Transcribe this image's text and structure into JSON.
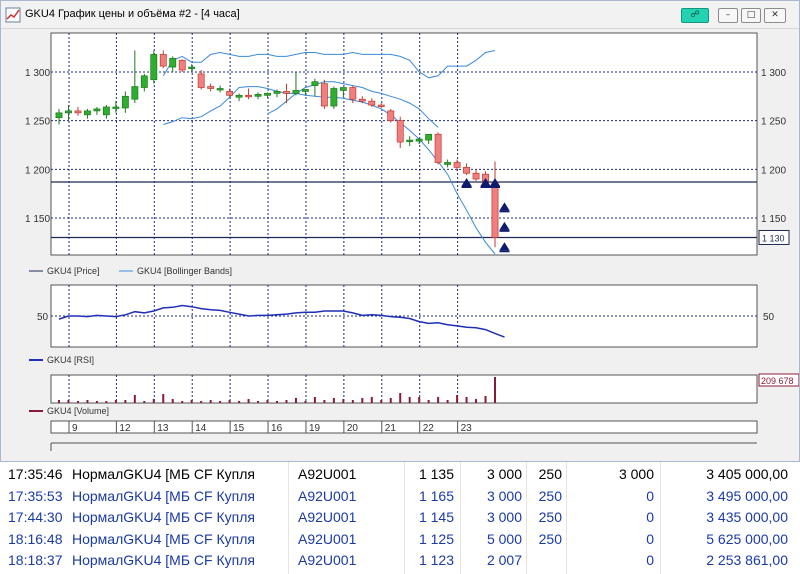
{
  "window": {
    "title": "GKU4 График цены и объёма #2 - [4 часа]",
    "buttons": {
      "link": "☍",
      "minimize": "–",
      "maximize": "□",
      "close": "✕"
    }
  },
  "price_panel": {
    "y_ticks": [
      "1 300",
      "1 250",
      "1 200",
      "1 150"
    ],
    "y_ticks_values": [
      1300,
      1250,
      1200,
      1150
    ],
    "current_price_label": "1 130",
    "hlines": [
      1187,
      1130
    ],
    "legend": [
      "GKU4 [Price]",
      "GKU4 [Bollinger Bands]"
    ]
  },
  "rsi_panel": {
    "y_tick": "50",
    "legend": "GKU4 [RSI]"
  },
  "volume_panel": {
    "current_volume_label": "209 678",
    "legend": "GKU4 [Volume]"
  },
  "date_axis": [
    "9",
    "12",
    "13",
    "14",
    "15",
    "16",
    "19",
    "20",
    "21",
    "22",
    "23"
  ],
  "colors": {
    "up_candle": "#2eae2e",
    "down_candle": "#f08080",
    "bollinger": "#3b8ad8",
    "rsi": "#1f2fb8",
    "volume": "#8b1a3a",
    "hline": "#1c2a55",
    "arrow": "#0d1a6e",
    "grid": "#1a2a8a",
    "row_black": "#000000",
    "row_blue": "#1a3aa8"
  },
  "chart_data": {
    "type": "candlestick",
    "candles": [
      {
        "o": 1253,
        "h": 1262,
        "l": 1246,
        "c": 1258
      },
      {
        "o": 1258,
        "h": 1266,
        "l": 1250,
        "c": 1260
      },
      {
        "o": 1260,
        "h": 1264,
        "l": 1255,
        "c": 1258
      },
      {
        "o": 1256,
        "h": 1262,
        "l": 1252,
        "c": 1260
      },
      {
        "o": 1260,
        "h": 1264,
        "l": 1256,
        "c": 1262
      },
      {
        "o": 1256,
        "h": 1266,
        "l": 1252,
        "c": 1264
      },
      {
        "o": 1263,
        "h": 1270,
        "l": 1258,
        "c": 1264
      },
      {
        "o": 1263,
        "h": 1280,
        "l": 1258,
        "c": 1275
      },
      {
        "o": 1272,
        "h": 1322,
        "l": 1268,
        "c": 1285
      },
      {
        "o": 1284,
        "h": 1298,
        "l": 1280,
        "c": 1296
      },
      {
        "o": 1292,
        "h": 1322,
        "l": 1288,
        "c": 1318
      },
      {
        "o": 1318,
        "h": 1322,
        "l": 1304,
        "c": 1306
      },
      {
        "o": 1305,
        "h": 1316,
        "l": 1300,
        "c": 1314
      },
      {
        "o": 1312,
        "h": 1313,
        "l": 1300,
        "c": 1302
      },
      {
        "o": 1305,
        "h": 1308,
        "l": 1300,
        "c": 1305
      },
      {
        "o": 1298,
        "h": 1302,
        "l": 1282,
        "c": 1284
      },
      {
        "o": 1285,
        "h": 1288,
        "l": 1280,
        "c": 1283
      },
      {
        "o": 1283,
        "h": 1286,
        "l": 1279,
        "c": 1283
      },
      {
        "o": 1280,
        "h": 1283,
        "l": 1274,
        "c": 1276
      },
      {
        "o": 1274,
        "h": 1278,
        "l": 1270,
        "c": 1276
      },
      {
        "o": 1276,
        "h": 1283,
        "l": 1272,
        "c": 1275
      },
      {
        "o": 1275,
        "h": 1279,
        "l": 1272,
        "c": 1277
      },
      {
        "o": 1276,
        "h": 1279,
        "l": 1273,
        "c": 1278
      },
      {
        "o": 1278,
        "h": 1282,
        "l": 1274,
        "c": 1280
      },
      {
        "o": 1280,
        "h": 1288,
        "l": 1268,
        "c": 1278
      },
      {
        "o": 1278,
        "h": 1300,
        "l": 1276,
        "c": 1281
      },
      {
        "o": 1280,
        "h": 1282,
        "l": 1276,
        "c": 1282
      },
      {
        "o": 1286,
        "h": 1293,
        "l": 1275,
        "c": 1290
      },
      {
        "o": 1288,
        "h": 1292,
        "l": 1262,
        "c": 1265
      },
      {
        "o": 1265,
        "h": 1285,
        "l": 1262,
        "c": 1283
      },
      {
        "o": 1281,
        "h": 1284,
        "l": 1274,
        "c": 1284
      },
      {
        "o": 1284,
        "h": 1286,
        "l": 1268,
        "c": 1272
      },
      {
        "o": 1272,
        "h": 1275,
        "l": 1268,
        "c": 1270
      },
      {
        "o": 1270,
        "h": 1273,
        "l": 1264,
        "c": 1266
      },
      {
        "o": 1266,
        "h": 1268,
        "l": 1263,
        "c": 1265
      },
      {
        "o": 1260,
        "h": 1262,
        "l": 1248,
        "c": 1250
      },
      {
        "o": 1250,
        "h": 1254,
        "l": 1222,
        "c": 1228
      },
      {
        "o": 1230,
        "h": 1234,
        "l": 1224,
        "c": 1230
      },
      {
        "o": 1229,
        "h": 1232,
        "l": 1226,
        "c": 1231
      },
      {
        "o": 1230,
        "h": 1236,
        "l": 1226,
        "c": 1236
      },
      {
        "o": 1236,
        "h": 1238,
        "l": 1205,
        "c": 1207
      },
      {
        "o": 1205,
        "h": 1210,
        "l": 1202,
        "c": 1207
      },
      {
        "o": 1207,
        "h": 1210,
        "l": 1198,
        "c": 1202
      },
      {
        "o": 1202,
        "h": 1206,
        "l": 1194,
        "c": 1196
      },
      {
        "o": 1196,
        "h": 1200,
        "l": 1188,
        "c": 1190
      },
      {
        "o": 1195,
        "h": 1198,
        "l": 1182,
        "c": 1188
      },
      {
        "o": 1187,
        "h": 1208,
        "l": 1120,
        "c": 1130
      }
    ],
    "bollinger_upper": [
      1296,
      1312,
      1316,
      1310,
      1310,
      1318,
      1320,
      1318,
      1316,
      1316,
      1318,
      1318,
      1316,
      1316,
      1318,
      1320,
      1320,
      1318,
      1318,
      1318,
      1320,
      1318,
      1318,
      1318,
      1318,
      1316,
      1312,
      1300,
      1294,
      1296,
      1306,
      1306,
      1306,
      1312,
      1320,
      1322
    ],
    "bollinger_middle": [
      1257,
      1262,
      1270,
      1278,
      1284,
      1287,
      1290,
      1290,
      1288,
      1286,
      1284,
      1280,
      1278,
      1275,
      1272,
      1268,
      1262,
      1252,
      1243
    ],
    "bollinger_lower": [
      1246,
      1249,
      1253,
      1252,
      1254,
      1260,
      1265,
      1274,
      1284,
      1285,
      1285,
      1283,
      1280,
      1278,
      1278,
      1276,
      1275,
      1274,
      1274,
      1273,
      1271,
      1269,
      1266,
      1262,
      1256,
      1248,
      1240,
      1231,
      1220,
      1208,
      1195,
      1175,
      1158,
      1140,
      1125,
      1113
    ],
    "rsi": [
      45,
      50,
      50,
      49,
      51,
      50,
      49,
      52,
      57,
      55,
      58,
      63,
      64,
      67,
      65,
      62,
      60,
      59,
      56,
      53,
      50,
      51,
      51,
      52,
      53,
      55,
      56,
      56,
      58,
      58,
      58,
      55,
      51,
      52,
      51,
      49,
      48,
      46,
      41,
      38,
      39,
      36,
      34,
      32,
      31,
      28,
      22,
      16
    ],
    "volume": [
      3,
      3,
      2,
      3,
      2,
      2,
      3,
      3,
      8,
      2,
      4,
      9,
      4,
      2,
      3,
      2,
      3,
      2,
      3,
      2,
      4,
      2,
      3,
      2,
      3,
      5,
      2,
      6,
      3,
      5,
      4,
      3,
      5,
      6,
      3,
      5,
      10,
      6,
      6,
      3,
      6,
      3,
      8,
      6,
      4,
      7,
      26
    ],
    "rsi_ylim": [
      0,
      100
    ],
    "price_ylim": [
      1112,
      1340
    ],
    "volume_ymax": 26
  },
  "trades_table": {
    "rows": [
      {
        "time": "17:35:46",
        "type": "НормалGKU4 [МБ СF Купля",
        "account": "A92U001",
        "price": "1 135",
        "qty": "3 000",
        "lot": "250",
        "rest": "3 000",
        "sum": "3 405 000,00",
        "color": "black"
      },
      {
        "time": "17:35:53",
        "type": "НормалGKU4 [МБ СF Купля",
        "account": "A92U001",
        "price": "1 165",
        "qty": "3 000",
        "lot": "250",
        "rest": "0",
        "sum": "3 495 000,00",
        "color": "blue"
      },
      {
        "time": "17:44:30",
        "type": "НормалGKU4 [МБ СF Купля",
        "account": "A92U001",
        "price": "1 145",
        "qty": "3 000",
        "lot": "250",
        "rest": "0",
        "sum": "3 435 000,00",
        "color": "blue"
      },
      {
        "time": "18:16:48",
        "type": "НормалGKU4 [МБ СF Купля",
        "account": "A92U001",
        "price": "1 125",
        "qty": "5 000",
        "lot": "250",
        "rest": "0",
        "sum": "5 625 000,00",
        "color": "blue"
      },
      {
        "time": "18:18:37",
        "type": "НормалGKU4 [МБ СF Купля",
        "account": "A92U001",
        "price": "1 123",
        "qty": "2 007",
        "lot": "",
        "rest": "0",
        "sum": "2 253 861,00",
        "color": "blue"
      }
    ]
  }
}
